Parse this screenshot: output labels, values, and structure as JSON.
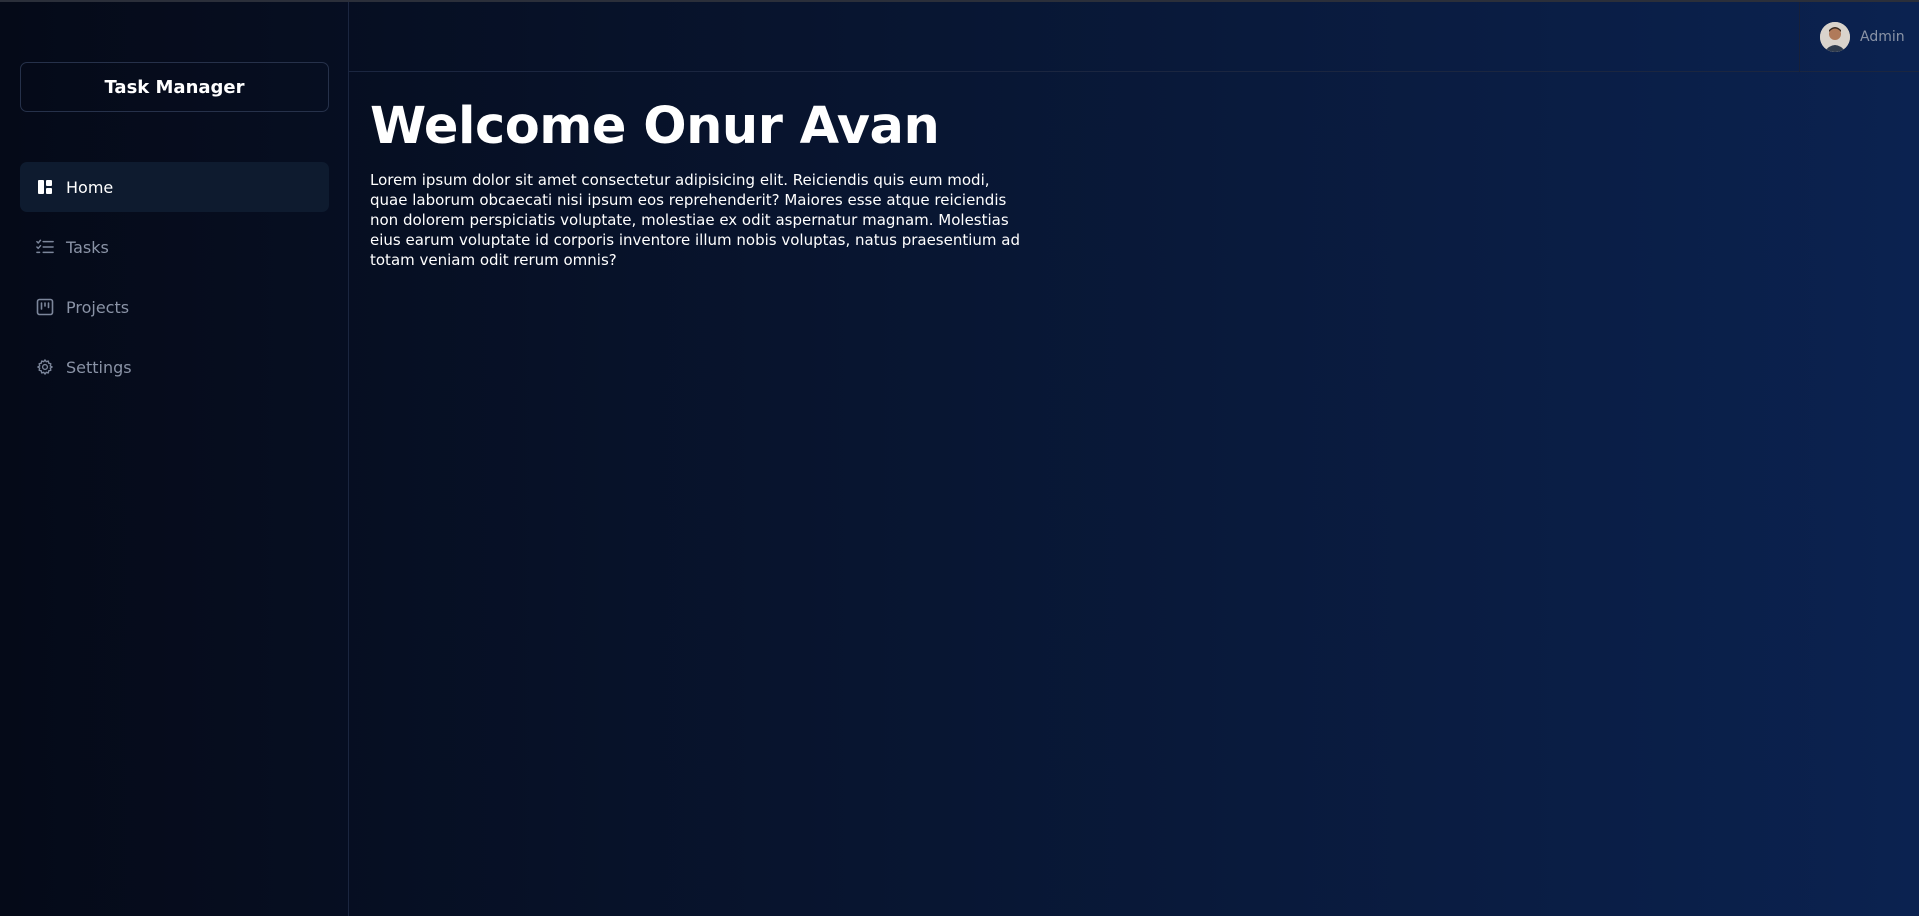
{
  "brand": {
    "title": "Task Manager"
  },
  "sidebar": {
    "items": [
      {
        "label": "Home",
        "icon": "dashboard-icon",
        "active": true
      },
      {
        "label": "Tasks",
        "icon": "checklist-icon",
        "active": false
      },
      {
        "label": "Projects",
        "icon": "kanban-icon",
        "active": false
      },
      {
        "label": "Settings",
        "icon": "gear-icon",
        "active": false
      }
    ]
  },
  "header": {
    "user": {
      "name": "Admin",
      "avatar": "avatar-photo"
    }
  },
  "main": {
    "title": "Welcome Onur Avan",
    "description": "Lorem ipsum dolor sit amet consectetur adipisicing elit. Reiciendis quis eum modi, quae laborum obcaecati nisi ipsum eos reprehenderit? Maiores esse atque reiciendis non dolorem perspiciatis voluptate, molestiae ex odit aspernatur magnam. Molestias eius earum voluptate id corporis inventore illum nobis voluptas, natus praesentium ad totam veniam odit rerum omnis?"
  },
  "colors": {
    "background_left": "#050a18",
    "background_right": "#0b2250",
    "active_item": "#0e1b2f",
    "muted_text": "#8a93a6",
    "text": "#ffffff"
  }
}
